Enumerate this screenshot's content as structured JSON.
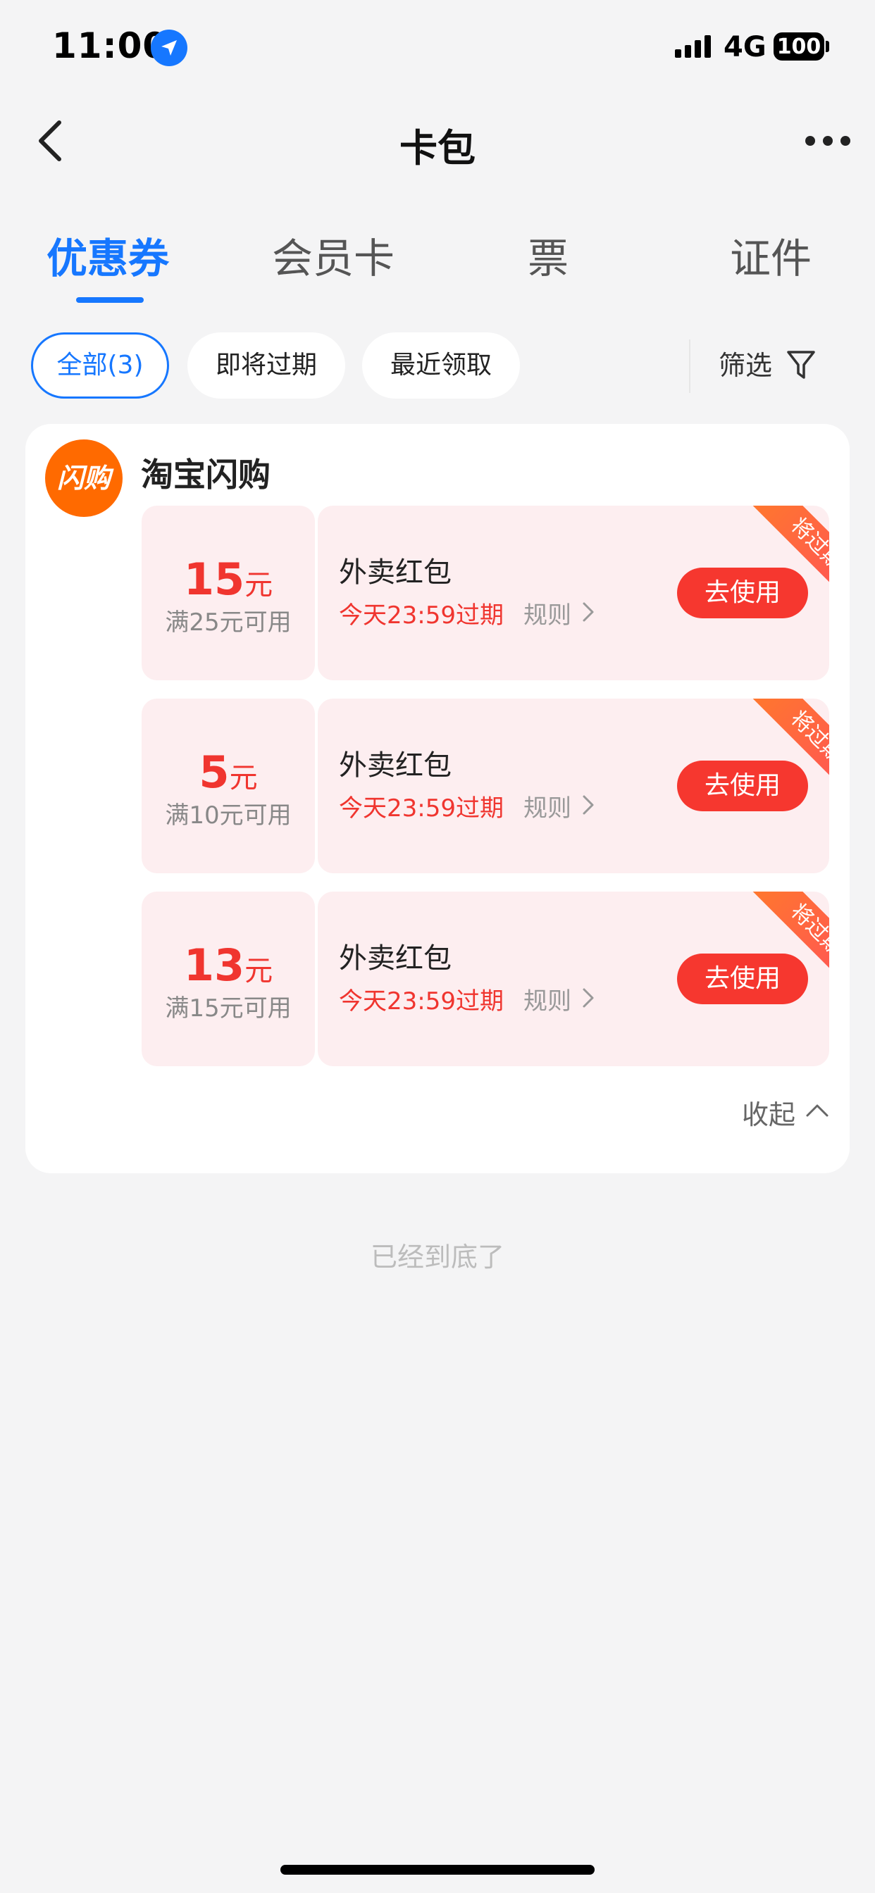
{
  "status_bar": {
    "time": "11:00",
    "network": "4G",
    "battery": "100"
  },
  "nav": {
    "title": "卡包"
  },
  "tabs": [
    {
      "label": "优惠券",
      "active": true
    },
    {
      "label": "会员卡",
      "active": false
    },
    {
      "label": "票",
      "active": false
    },
    {
      "label": "证件",
      "active": false
    }
  ],
  "filters": {
    "chips": [
      "全部(3)",
      "即将过期",
      "最近领取"
    ],
    "filter_label": "筛选"
  },
  "store": {
    "logo_text": "闪购",
    "name": "淘宝闪购",
    "coupons": [
      {
        "amount": "15",
        "unit": "元",
        "threshold": "满25元可用",
        "title": "外卖红包",
        "expiry": "今天23:59过期",
        "rules": "规则",
        "button": "去使用",
        "ribbon": "将过期"
      },
      {
        "amount": "5",
        "unit": "元",
        "threshold": "满10元可用",
        "title": "外卖红包",
        "expiry": "今天23:59过期",
        "rules": "规则",
        "button": "去使用",
        "ribbon": "将过期"
      },
      {
        "amount": "13",
        "unit": "元",
        "threshold": "满15元可用",
        "title": "外卖红包",
        "expiry": "今天23:59过期",
        "rules": "规则",
        "button": "去使用",
        "ribbon": "将过期"
      }
    ],
    "collapse_label": "收起"
  },
  "footer": {
    "end_text": "已经到底了"
  },
  "colors": {
    "accent": "#1677ff",
    "coupon_red": "#f0352f",
    "brand_orange": "#ff6a00"
  }
}
